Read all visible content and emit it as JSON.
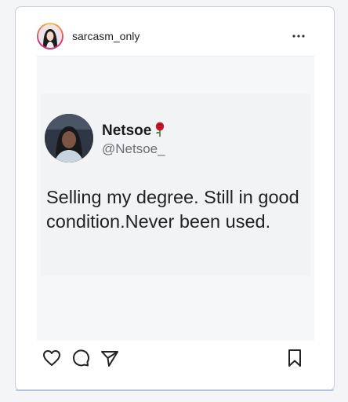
{
  "post": {
    "username": "sarcasm_only",
    "more_icon": "more-horizontal-icon",
    "avatar_icon": "profile-avatar"
  },
  "tweet": {
    "display_name": "Netsoe",
    "name_emoji": "rose-icon",
    "handle": "@Netsoe_",
    "text": "Selling my degree. Still in good condition.Never been used."
  },
  "actions": {
    "like": "heart-icon",
    "comment": "comment-icon",
    "share": "send-icon",
    "save": "bookmark-icon"
  },
  "colors": {
    "card_border": "#c9ccd2",
    "accent": "#b8c6de",
    "text_primary": "#222222",
    "text_secondary": "#6b6f75",
    "rose": "#c8182a"
  }
}
